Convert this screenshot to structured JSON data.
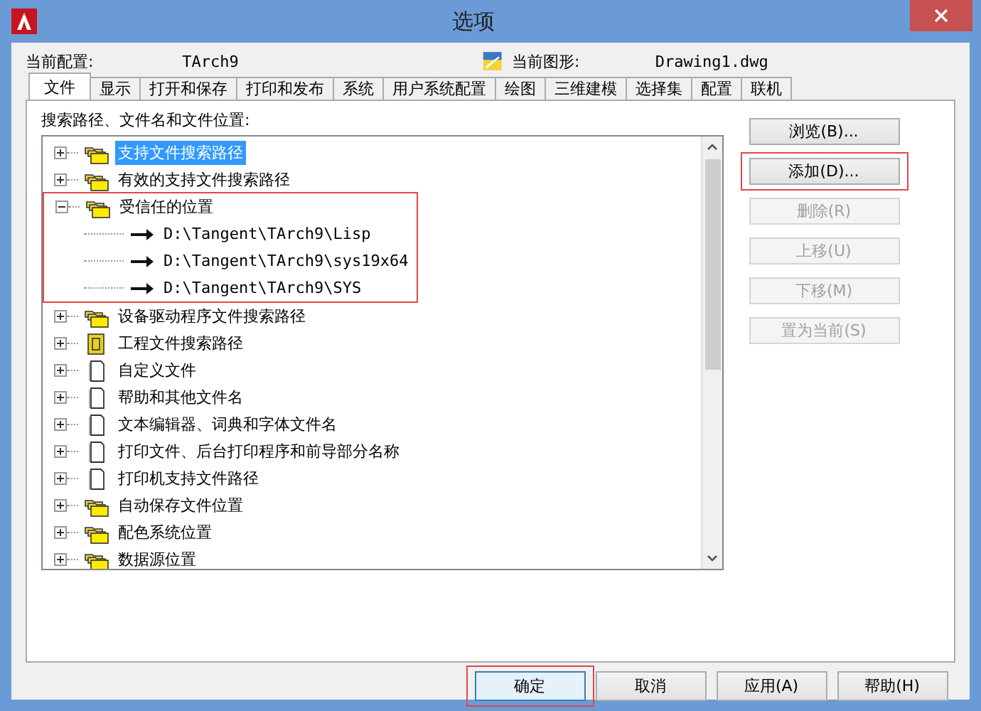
{
  "window": {
    "title": "选项"
  },
  "header": {
    "profile_label": "当前配置:",
    "profile_value": "TArch9",
    "drawing_label": "当前图形:",
    "drawing_value": "Drawing1.dwg"
  },
  "tabs": [
    {
      "label": "文件",
      "selected": true
    },
    {
      "label": "显示",
      "selected": false
    },
    {
      "label": "打开和保存",
      "selected": false
    },
    {
      "label": "打印和发布",
      "selected": false
    },
    {
      "label": "系统",
      "selected": false
    },
    {
      "label": "用户系统配置",
      "selected": false
    },
    {
      "label": "绘图",
      "selected": false
    },
    {
      "label": "三维建模",
      "selected": false
    },
    {
      "label": "选择集",
      "selected": false
    },
    {
      "label": "配置",
      "selected": false
    },
    {
      "label": "联机",
      "selected": false
    }
  ],
  "tree_label": "搜索路径、文件名和文件位置:",
  "tree": [
    {
      "label": "支持文件搜索路径",
      "kind": "folder",
      "selected": true,
      "expanded": false,
      "highlighted": false
    },
    {
      "label": "有效的支持文件搜索路径",
      "kind": "folder",
      "selected": false,
      "expanded": false,
      "highlighted": false
    },
    {
      "label": "受信任的位置",
      "kind": "folder",
      "selected": false,
      "expanded": true,
      "highlighted": true,
      "children": [
        {
          "label": "D:\\Tangent\\TArch9\\Lisp",
          "kind": "path",
          "selected": false
        },
        {
          "label": "D:\\Tangent\\TArch9\\sys19x64",
          "kind": "path",
          "selected": false
        },
        {
          "label": "D:\\Tangent\\TArch9\\SYS",
          "kind": "path",
          "selected": false
        }
      ]
    },
    {
      "label": "设备驱动程序文件搜索路径",
      "kind": "folder",
      "selected": false,
      "expanded": false,
      "highlighted": false
    },
    {
      "label": "工程文件搜索路径",
      "kind": "project",
      "selected": false,
      "expanded": false,
      "highlighted": false
    },
    {
      "label": "自定义文件",
      "kind": "file",
      "selected": false,
      "expanded": false,
      "highlighted": false
    },
    {
      "label": "帮助和其他文件名",
      "kind": "file",
      "selected": false,
      "expanded": false,
      "highlighted": false
    },
    {
      "label": "文本编辑器、词典和字体文件名",
      "kind": "file",
      "selected": false,
      "expanded": false,
      "highlighted": false
    },
    {
      "label": "打印文件、后台打印程序和前导部分名称",
      "kind": "file",
      "selected": false,
      "expanded": false,
      "highlighted": false
    },
    {
      "label": "打印机支持文件路径",
      "kind": "file",
      "selected": false,
      "expanded": false,
      "highlighted": false
    },
    {
      "label": "自动保存文件位置",
      "kind": "folder",
      "selected": false,
      "expanded": false,
      "highlighted": false
    },
    {
      "label": "配色系统位置",
      "kind": "folder",
      "selected": false,
      "expanded": false,
      "highlighted": false
    },
    {
      "label": "数据源位置",
      "kind": "folder",
      "selected": false,
      "expanded": false,
      "highlighted": false
    }
  ],
  "side_buttons": [
    {
      "label": "浏览(B)...",
      "disabled": false,
      "highlighted": false
    },
    {
      "label": "添加(D)...",
      "disabled": false,
      "highlighted": true
    },
    {
      "label": "删除(R)",
      "disabled": true,
      "highlighted": false
    },
    {
      "label": "上移(U)",
      "disabled": true,
      "highlighted": false
    },
    {
      "label": "下移(M)",
      "disabled": true,
      "highlighted": false
    },
    {
      "label": "置为当前(S)",
      "disabled": true,
      "highlighted": false
    }
  ],
  "buttons": [
    {
      "label": "确定",
      "default": true,
      "highlighted": true
    },
    {
      "label": "取消",
      "default": false,
      "highlighted": false
    },
    {
      "label": "应用(A)",
      "default": false,
      "highlighted": false
    },
    {
      "label": "帮助(H)",
      "default": false,
      "highlighted": false
    }
  ]
}
